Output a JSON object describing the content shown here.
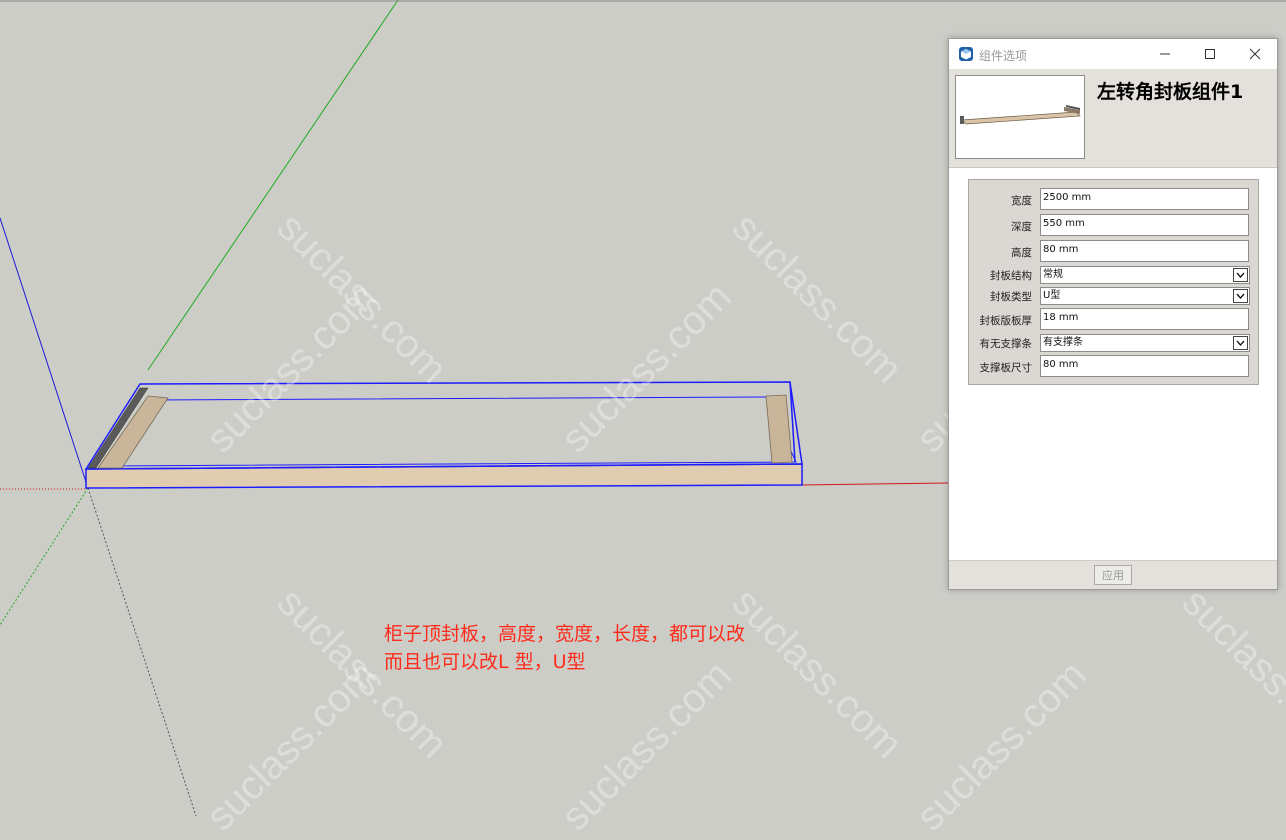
{
  "watermark": "suclass.com",
  "caption": {
    "line1": "柜子顶封板，高度，宽度，长度，都可以改",
    "line2": "而且也可以改L 型，U型"
  },
  "colors": {
    "viewport_bg": "#cdcdc8",
    "axis_green": "#1faa1f",
    "axis_blue": "#1a1ad4",
    "axis_red": "#d01818",
    "selection": "#1c1cff",
    "wood": "#d9c4a8",
    "caption": "#ff2a1a"
  },
  "dialog": {
    "title": "组件选项",
    "component_name": "左转角封板组件1",
    "icons": [
      "minimize-icon",
      "maximize-icon",
      "close-icon"
    ],
    "fields": [
      {
        "label": "宽度",
        "value": "2500 mm",
        "type": "text"
      },
      {
        "label": "深度",
        "value": "550 mm",
        "type": "text"
      },
      {
        "label": "高度",
        "value": "80 mm",
        "type": "text"
      },
      {
        "label": "封板结构",
        "value": "常规",
        "type": "select"
      },
      {
        "label": "封板类型",
        "value": "U型",
        "type": "select"
      },
      {
        "label": "封板版板厚",
        "value": "18 mm",
        "type": "text"
      },
      {
        "label": "有无支撑条",
        "value": "有支撑条",
        "type": "select"
      },
      {
        "label": "支撑板尺寸",
        "value": "80 mm",
        "type": "text"
      }
    ],
    "apply_label": "应用"
  }
}
